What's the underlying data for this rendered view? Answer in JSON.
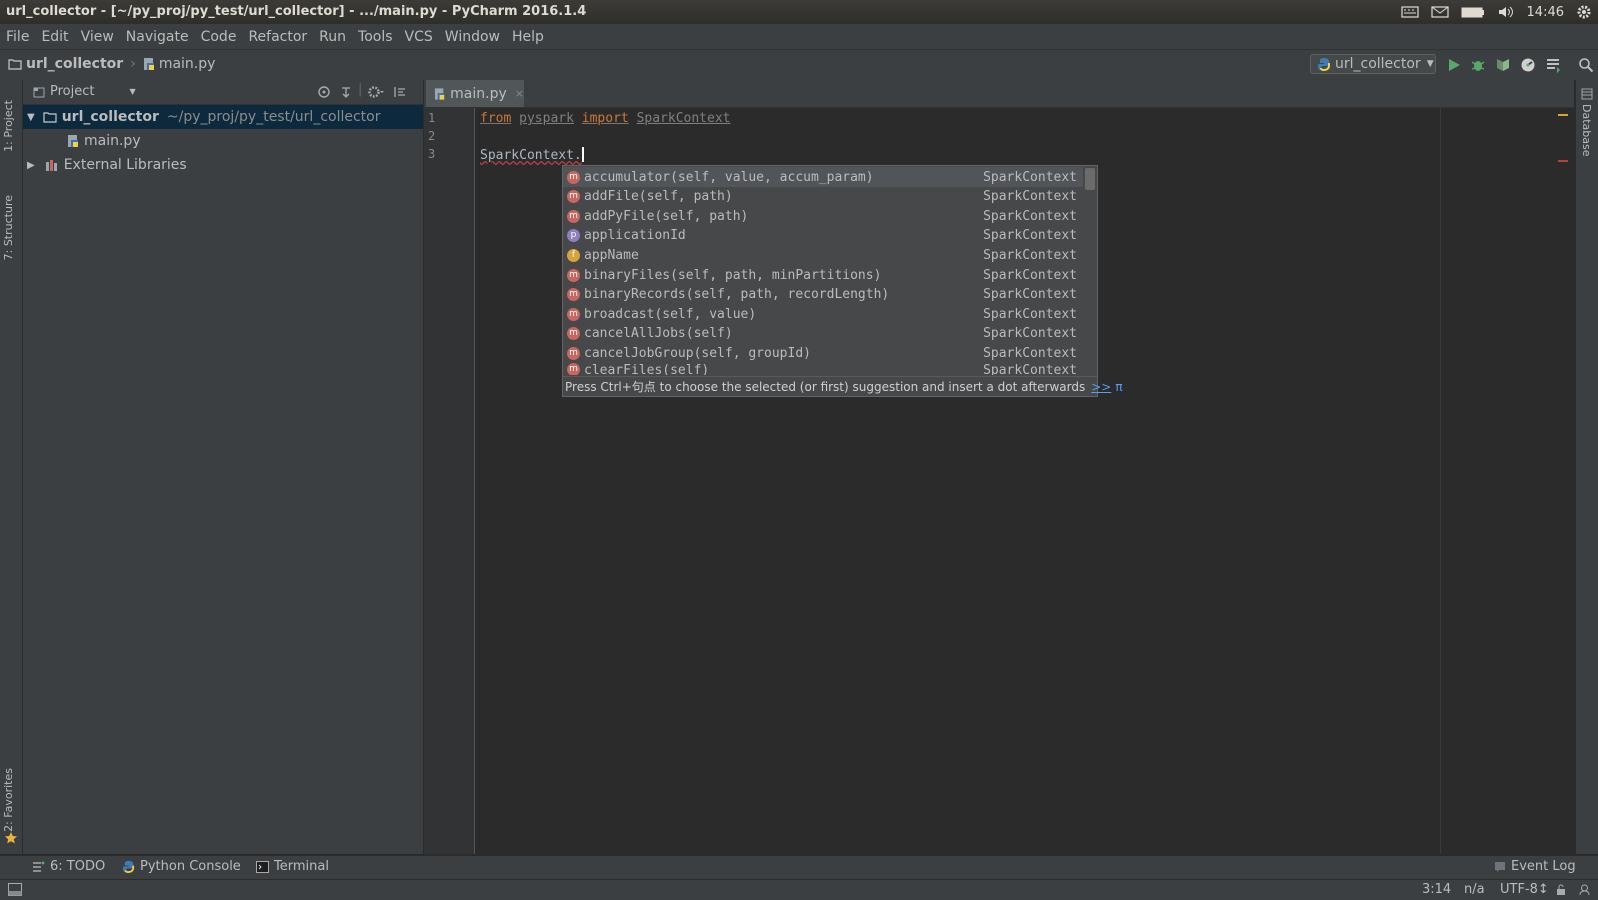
{
  "window_title": "url_collector - [~/py_proj/py_test/url_collector] - .../main.py - PyCharm 2016.1.4",
  "tray": {
    "time": "14:46"
  },
  "menu": [
    "File",
    "Edit",
    "View",
    "Navigate",
    "Code",
    "Refactor",
    "Run",
    "Tools",
    "VCS",
    "Window",
    "Help"
  ],
  "navbar": {
    "project": "url_collector",
    "file": "main.py",
    "run_config": "url_collector"
  },
  "side_tabs": {
    "project": "1: Project",
    "structure": "7: Structure",
    "favorites": "2: Favorites",
    "database": "Database"
  },
  "project_panel": {
    "view_selector": "Project",
    "root_name": "url_collector",
    "root_path": "~/py_proj/py_test/url_collector",
    "file": "main.py",
    "external": "External Libraries"
  },
  "editor": {
    "tab": "main.py",
    "line_numbers": [
      "1",
      "2",
      "3"
    ],
    "line1": {
      "kw_from": "from",
      "module": "pyspark",
      "kw_import": "import",
      "name": "SparkContext"
    },
    "line3": "SparkContext."
  },
  "completion": {
    "items": [
      {
        "icon": "m",
        "text": "accumulator(self, value, accum_param)",
        "cls": "SparkContext"
      },
      {
        "icon": "m",
        "text": "addFile(self, path)",
        "cls": "SparkContext"
      },
      {
        "icon": "m",
        "text": "addPyFile(self, path)",
        "cls": "SparkContext"
      },
      {
        "icon": "p",
        "text": "applicationId",
        "cls": "SparkContext"
      },
      {
        "icon": "f",
        "text": "appName",
        "cls": "SparkContext"
      },
      {
        "icon": "m",
        "text": "binaryFiles(self, path, minPartitions)",
        "cls": "SparkContext"
      },
      {
        "icon": "m",
        "text": "binaryRecords(self, path, recordLength)",
        "cls": "SparkContext"
      },
      {
        "icon": "m",
        "text": "broadcast(self, value)",
        "cls": "SparkContext"
      },
      {
        "icon": "m",
        "text": "cancelAllJobs(self)",
        "cls": "SparkContext"
      },
      {
        "icon": "m",
        "text": "cancelJobGroup(self, groupId)",
        "cls": "SparkContext"
      },
      {
        "icon": "m",
        "text": "clearFiles(self)",
        "cls": "SparkContext"
      }
    ],
    "footer": "Press Ctrl+句点 to choose the selected (or first) suggestion and insert a dot afterwards",
    "footer_link": ">>",
    "footer_pi": "π"
  },
  "bottom_tabs": {
    "todo": "6: TODO",
    "console": "Python Console",
    "terminal": "Terminal",
    "event_log": "Event Log"
  },
  "status": {
    "position": "3:14",
    "na": "n/a",
    "encoding": "UTF-8↕"
  },
  "colors": {
    "keyword": "#cc7832",
    "selection": "#0d293e",
    "background": "#2b2b2b",
    "panel": "#3c3f41"
  }
}
